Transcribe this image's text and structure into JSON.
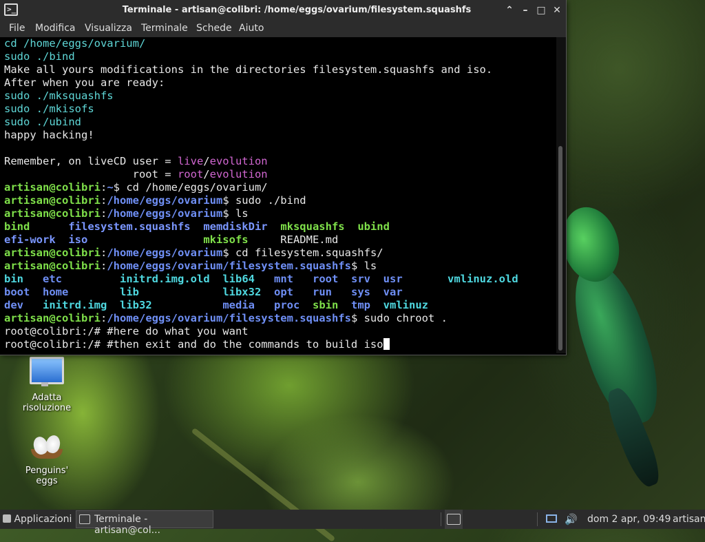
{
  "window": {
    "title": "Terminale - artisan@colibri: /home/eggs/ovarium/filesystem.squashfs",
    "menu": [
      "File",
      "Modifica",
      "Visualizza",
      "Terminale",
      "Schede",
      "Aiuto"
    ]
  },
  "terminal": {
    "lines": [
      [
        {
          "t": "cd /home/eggs/ovarium/",
          "s": "c"
        }
      ],
      [
        {
          "t": "sudo ./bind",
          "s": "c"
        }
      ],
      [
        {
          "t": "Make all yours modifications in the directories filesystem.squashfs and iso.",
          "s": "w"
        }
      ],
      [
        {
          "t": "After when you are ready:",
          "s": "w"
        }
      ],
      [
        {
          "t": "sudo ./mksquashfs",
          "s": "c"
        }
      ],
      [
        {
          "t": "sudo ./mkisofs",
          "s": "c"
        }
      ],
      [
        {
          "t": "sudo ./ubind",
          "s": "c"
        }
      ],
      [
        {
          "t": "happy hacking!",
          "s": "w"
        }
      ],
      [
        {
          "t": "",
          "s": "w"
        }
      ],
      [
        {
          "t": "Remember, on liveCD user = ",
          "s": "w"
        },
        {
          "t": "live",
          "s": "m"
        },
        {
          "t": "/",
          "s": "w"
        },
        {
          "t": "evolution",
          "s": "m"
        }
      ],
      [
        {
          "t": "                    root = ",
          "s": "w"
        },
        {
          "t": "root",
          "s": "m"
        },
        {
          "t": "/",
          "s": "w"
        },
        {
          "t": "evolution",
          "s": "m"
        }
      ],
      [
        {
          "t": "artisan@colibri",
          "s": "g"
        },
        {
          "t": ":",
          "s": "w"
        },
        {
          "t": "~",
          "s": "b"
        },
        {
          "t": "$ cd /home/eggs/ovarium/",
          "s": "w"
        }
      ],
      [
        {
          "t": "artisan@colibri",
          "s": "g"
        },
        {
          "t": ":",
          "s": "w"
        },
        {
          "t": "/home/eggs/ovarium",
          "s": "b"
        },
        {
          "t": "$ sudo ./bind",
          "s": "w"
        }
      ],
      [
        {
          "t": "artisan@colibri",
          "s": "g"
        },
        {
          "t": ":",
          "s": "w"
        },
        {
          "t": "/home/eggs/ovarium",
          "s": "b"
        },
        {
          "t": "$ ls",
          "s": "w"
        }
      ],
      [
        {
          "t": "bind",
          "s": "g"
        },
        {
          "t": "      ",
          "s": "w"
        },
        {
          "t": "filesystem.squashfs",
          "s": "bn b"
        },
        {
          "t": "  ",
          "s": "w"
        },
        {
          "t": "memdiskDir",
          "s": "bn b"
        },
        {
          "t": "  ",
          "s": "w"
        },
        {
          "t": "mksquashfs",
          "s": "g"
        },
        {
          "t": "  ",
          "s": "w"
        },
        {
          "t": "ubind",
          "s": "g"
        }
      ],
      [
        {
          "t": "efi-work",
          "s": "bn b"
        },
        {
          "t": "  ",
          "s": "w"
        },
        {
          "t": "iso",
          "s": "bn b"
        },
        {
          "t": "                  ",
          "s": "w"
        },
        {
          "t": "mkisofs",
          "s": "g"
        },
        {
          "t": "     README.md",
          "s": "w"
        }
      ],
      [
        {
          "t": "artisan@colibri",
          "s": "g"
        },
        {
          "t": ":",
          "s": "w"
        },
        {
          "t": "/home/eggs/ovarium",
          "s": "b"
        },
        {
          "t": "$ cd filesystem.squashfs/",
          "s": "w"
        }
      ],
      [
        {
          "t": "artisan@colibri",
          "s": "g"
        },
        {
          "t": ":",
          "s": "w"
        },
        {
          "t": "/home/eggs/ovarium/filesystem.squashfs",
          "s": "b"
        },
        {
          "t": "$ ls",
          "s": "w"
        }
      ],
      [
        {
          "t": "bin",
          "s": "cb"
        },
        {
          "t": "   ",
          "s": "w"
        },
        {
          "t": "etc",
          "s": "b"
        },
        {
          "t": "         ",
          "s": "w"
        },
        {
          "t": "initrd.img.old",
          "s": "cb"
        },
        {
          "t": "  ",
          "s": "w"
        },
        {
          "t": "lib64",
          "s": "cb"
        },
        {
          "t": "   ",
          "s": "w"
        },
        {
          "t": "mnt",
          "s": "b"
        },
        {
          "t": "   ",
          "s": "w"
        },
        {
          "t": "root",
          "s": "b"
        },
        {
          "t": "  ",
          "s": "w"
        },
        {
          "t": "srv",
          "s": "b"
        },
        {
          "t": "  ",
          "s": "w"
        },
        {
          "t": "usr",
          "s": "b"
        },
        {
          "t": "       ",
          "s": "w"
        },
        {
          "t": "vmlinuz.old",
          "s": "cb"
        }
      ],
      [
        {
          "t": "boot",
          "s": "b"
        },
        {
          "t": "  ",
          "s": "w"
        },
        {
          "t": "home",
          "s": "b"
        },
        {
          "t": "        ",
          "s": "w"
        },
        {
          "t": "lib",
          "s": "cb"
        },
        {
          "t": "             ",
          "s": "w"
        },
        {
          "t": "libx32",
          "s": "cb"
        },
        {
          "t": "  ",
          "s": "w"
        },
        {
          "t": "opt",
          "s": "b"
        },
        {
          "t": "   ",
          "s": "w"
        },
        {
          "t": "run",
          "s": "b"
        },
        {
          "t": "   ",
          "s": "w"
        },
        {
          "t": "sys",
          "s": "b"
        },
        {
          "t": "  ",
          "s": "w"
        },
        {
          "t": "var",
          "s": "b"
        }
      ],
      [
        {
          "t": "dev",
          "s": "b"
        },
        {
          "t": "   ",
          "s": "w"
        },
        {
          "t": "initrd.img",
          "s": "cb"
        },
        {
          "t": "  ",
          "s": "w"
        },
        {
          "t": "lib32",
          "s": "cb"
        },
        {
          "t": "           ",
          "s": "w"
        },
        {
          "t": "media",
          "s": "b"
        },
        {
          "t": "   ",
          "s": "w"
        },
        {
          "t": "proc",
          "s": "b"
        },
        {
          "t": "  ",
          "s": "w"
        },
        {
          "t": "sbin",
          "s": "g"
        },
        {
          "t": "  ",
          "s": "w"
        },
        {
          "t": "tmp",
          "s": "b"
        },
        {
          "t": "  ",
          "s": "w"
        },
        {
          "t": "vmlinuz",
          "s": "cb"
        }
      ],
      [
        {
          "t": "artisan@colibri",
          "s": "g"
        },
        {
          "t": ":",
          "s": "w"
        },
        {
          "t": "/home/eggs/ovarium/filesystem.squashfs",
          "s": "b"
        },
        {
          "t": "$ sudo chroot .",
          "s": "w"
        }
      ],
      [
        {
          "t": "root@colibri:/# #here do what you want",
          "s": "w"
        }
      ],
      [
        {
          "t": "root@colibri:/# #then exit and do the commands to build iso",
          "s": "w"
        }
      ]
    ]
  },
  "desktop": {
    "icons": [
      {
        "label_line1": "Adatta",
        "label_line2": "risoluzione",
        "icon": "monitor-icon"
      },
      {
        "label_line1": "Penguins'",
        "label_line2": "eggs",
        "icon": "eggs-icon"
      }
    ]
  },
  "taskbar": {
    "apps_menu": "Applicazioni",
    "task": "Terminale - artisan@col...",
    "clock": "dom   2 apr, 09:49",
    "user": "artisan"
  }
}
